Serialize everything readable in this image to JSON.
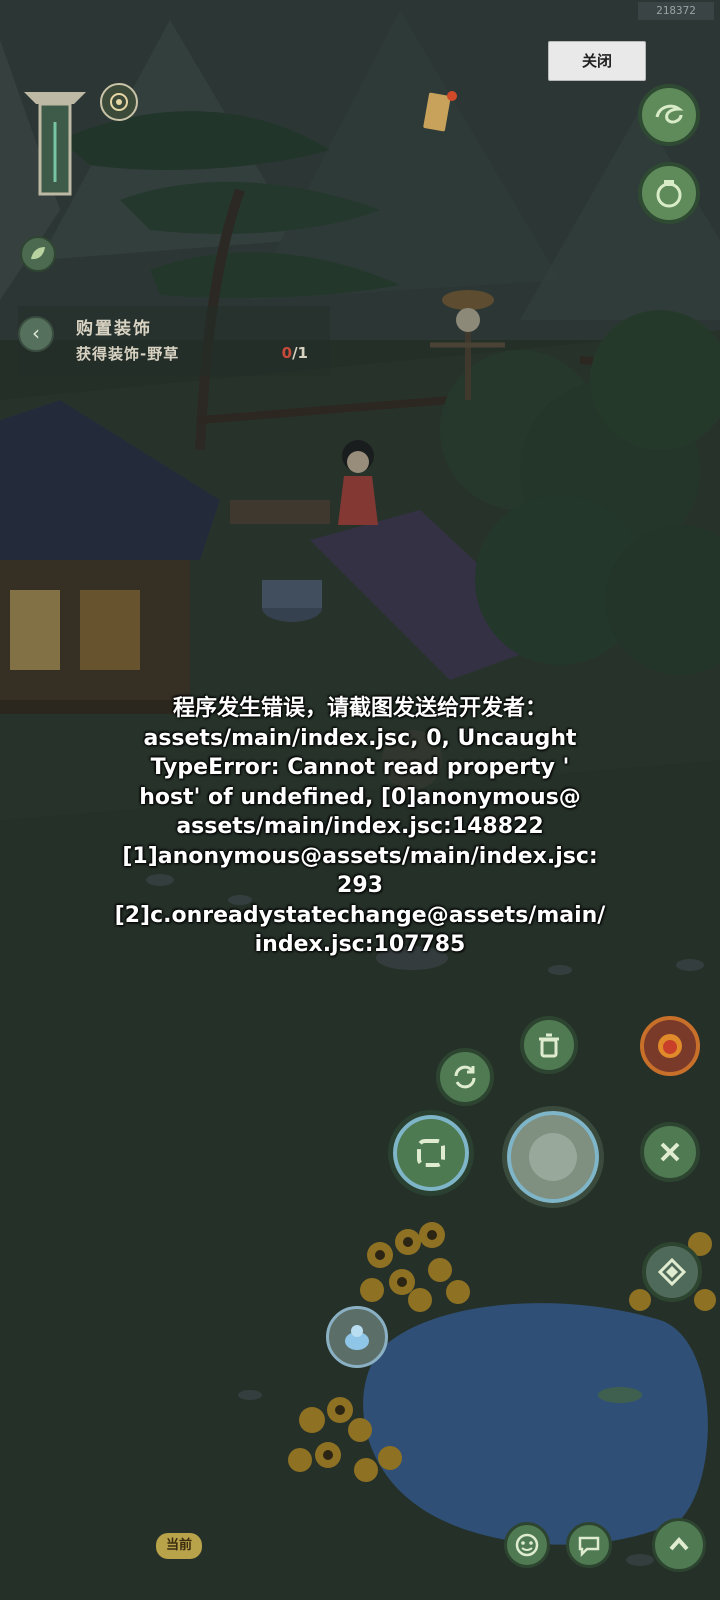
{
  "build_tag": "218372",
  "close_button": {
    "label": "关闭"
  },
  "quest": {
    "title": "购置装饰",
    "subtitle": "获得装饰-野草",
    "progress_current": "0",
    "progress_total": "/1"
  },
  "error": {
    "lines": [
      "程序发生错误，请截图发送给开发者：",
      "assets/main/index.jsc, 0, Uncaught",
      "TypeError: Cannot read property '",
      "host' of undefined, [0]anonymous@",
      "assets/main/index.jsc:148822",
      "[1]anonymous@assets/main/index.jsc:",
      "293",
      "[2]c.onreadystatechange@assets/main/",
      "index.jsc:107785"
    ]
  },
  "now_tag": "当前",
  "colors": {
    "button_green": "#5f8a5a",
    "button_ring": "#2f4a33",
    "water": "#3f6fb0",
    "sunflower": "#d9a52a",
    "overlay": "rgba(20,28,24,0.45)"
  },
  "icons": {
    "map_totem": "totem-icon",
    "compass": "compass-icon",
    "scroll_notice": "scroll-icon",
    "wind_skill": "wind-swirl-icon",
    "pot": "pot-icon",
    "leaf": "leaf-icon",
    "trash": "trash-icon",
    "refresh": "refresh-icon",
    "rotate": "rotate-icon",
    "confirm": "joystick-icon",
    "cancel": "cancel-icon",
    "lion_event": "lion-icon",
    "decor": "decor-icon",
    "water_pet": "water-pet-icon",
    "emote": "emote-icon",
    "chat": "chat-icon",
    "up": "up-arrow-icon"
  }
}
